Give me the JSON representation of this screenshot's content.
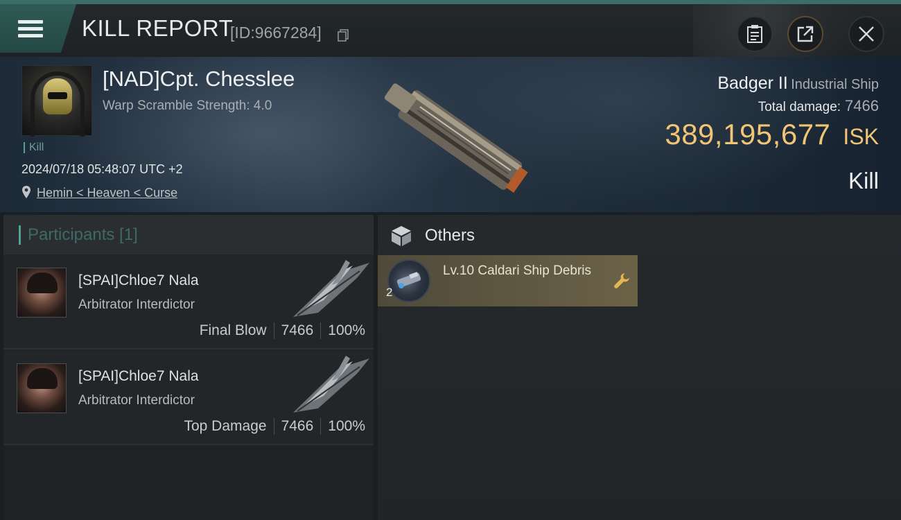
{
  "header": {
    "title": "KILL REPORT",
    "report_id": "[ID:9667284]"
  },
  "victim": {
    "name": "[NAD]Cpt. Chesslee",
    "warp_scramble": "Warp Scramble Strength: 4.0",
    "tag": "Kill",
    "datetime": "2024/07/18 05:48:07 UTC +2",
    "location": "Hemin < Heaven < Curse",
    "ship_name": "Badger II",
    "ship_class": "Industrial Ship",
    "total_damage_label": "Total damage:",
    "total_damage": "7466",
    "isk_value": "389,195,677",
    "isk_unit": "ISK",
    "result": "Kill"
  },
  "participants": {
    "header": "Participants [1]",
    "rows": [
      {
        "name": "[SPAI]Chloe7 Nala",
        "ship": "Arbitrator Interdictor",
        "role": "Final Blow",
        "damage": "7466",
        "percent": "100%"
      },
      {
        "name": "[SPAI]Chloe7 Nala",
        "ship": "Arbitrator Interdictor",
        "role": "Top Damage",
        "damage": "7466",
        "percent": "100%"
      }
    ]
  },
  "others": {
    "header": "Others",
    "items": [
      {
        "name": "Lv.10 Caldari Ship Debris",
        "quantity": "2"
      }
    ]
  },
  "colors": {
    "accent_teal": "#4ea292",
    "isk_gold": "#f1c575",
    "item_card": "#6b6247"
  },
  "icons": [
    "menu-icon",
    "copy-icon",
    "clipboard-icon",
    "share-icon",
    "close-icon",
    "location-pin-icon",
    "cube-icon",
    "wrench-icon"
  ]
}
